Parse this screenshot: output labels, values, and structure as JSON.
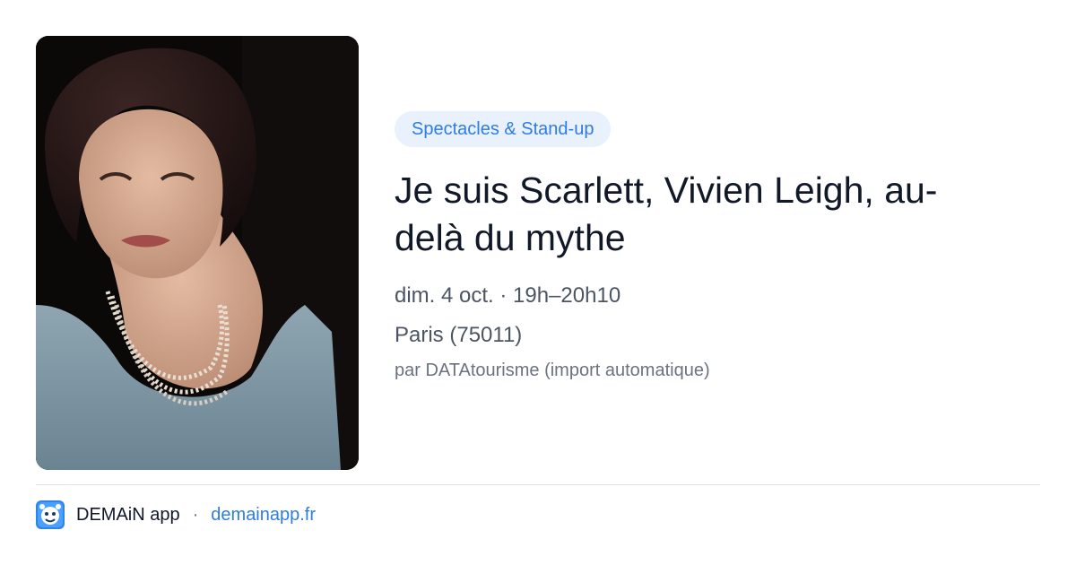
{
  "event": {
    "image_alt": "Photo of the performer",
    "category": "Spectacles & Stand-up",
    "title": "Je suis Scarlett, Vivien Leigh, au-delà du mythe",
    "date_time": "dim. 4 oct. · 19h–20h10",
    "location": "Paris (75011)",
    "source": "par DATAtourisme (import automatique)"
  },
  "footer": {
    "logo_icon": "demain-app-logo-icon",
    "app_name": "DEMAiN app",
    "separator": "·",
    "url": "demainapp.fr"
  },
  "colors": {
    "accent": "#2f7de1",
    "badge_bg": "#e8f1fc",
    "title": "#111827",
    "meta": "#4b5563",
    "divider": "#dfe3ea"
  }
}
